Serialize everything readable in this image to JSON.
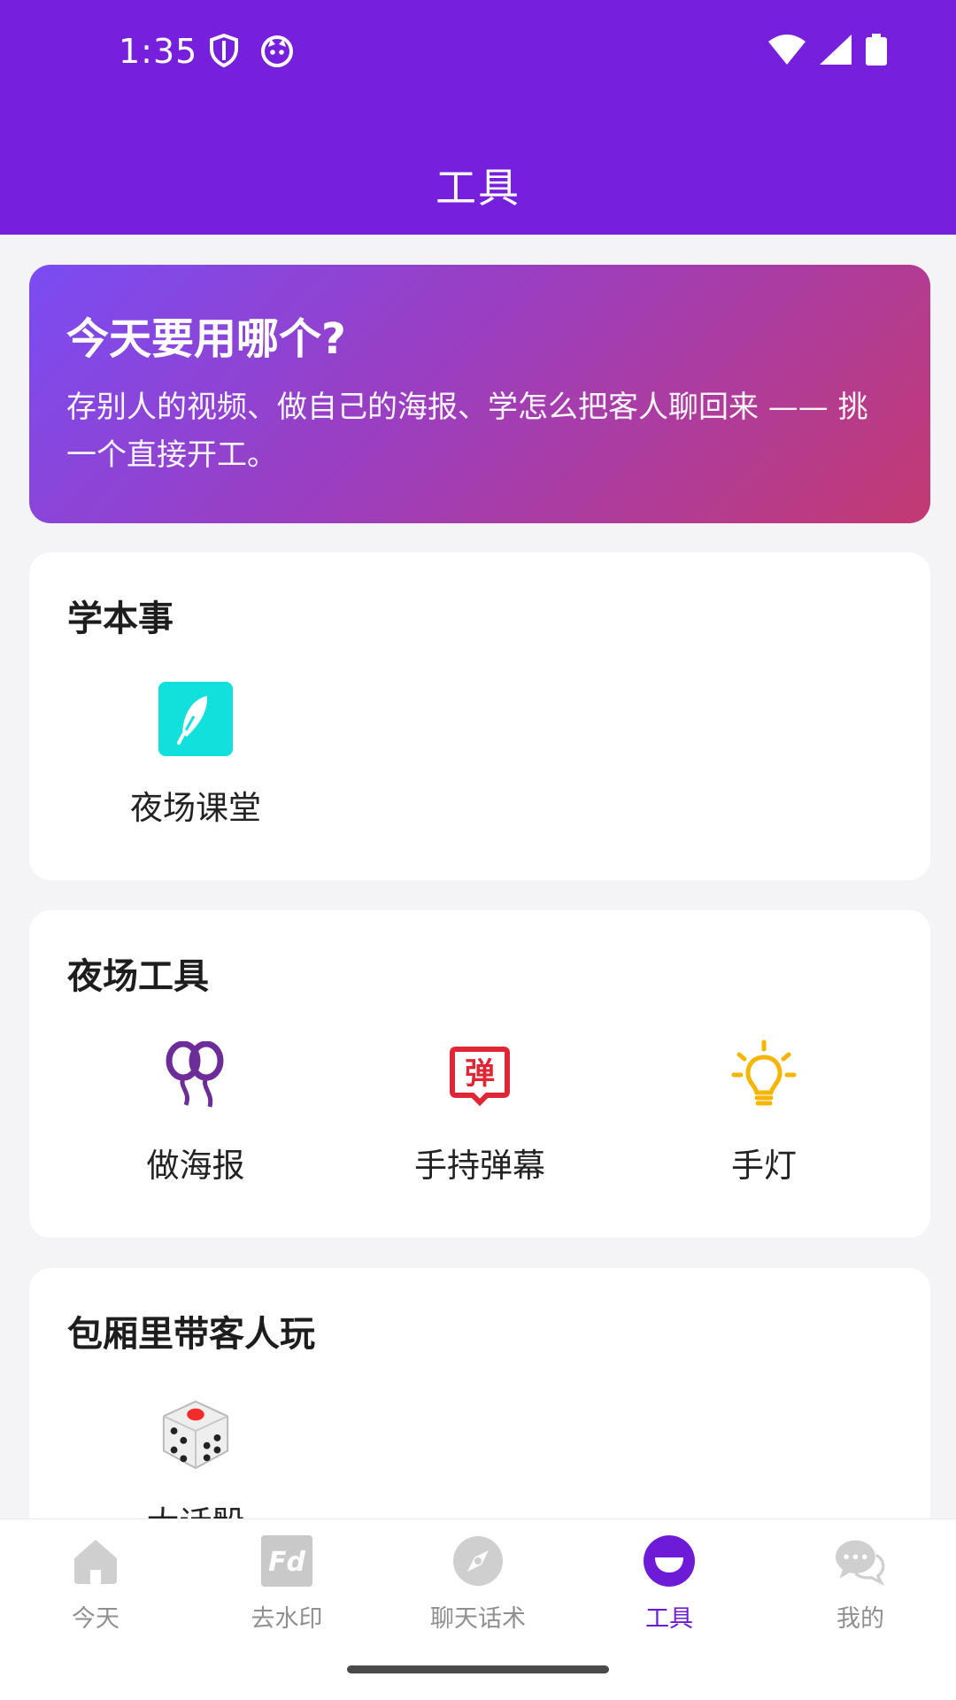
{
  "status": {
    "time": "1:35"
  },
  "header": {
    "title": "工具"
  },
  "hero": {
    "title": "今天要用哪个?",
    "description": "存别人的视频、做自己的海报、学怎么把客人聊回来 —— 挑一个直接开工。"
  },
  "sections": [
    {
      "title": "学本事",
      "items": [
        {
          "label": "夜场课堂",
          "icon": "feather-icon"
        }
      ]
    },
    {
      "title": "夜场工具",
      "items": [
        {
          "label": "做海报",
          "icon": "balloons-icon"
        },
        {
          "label": "手持弹幕",
          "icon": "danmaku-icon"
        },
        {
          "label": "手灯",
          "icon": "lightbulb-icon"
        }
      ]
    },
    {
      "title": "包厢里带客人玩",
      "items": [
        {
          "label": "大话骰",
          "icon": "dice-icon"
        }
      ]
    }
  ],
  "tabs": [
    {
      "label": "今天",
      "icon": "home-icon"
    },
    {
      "label": "去水印",
      "icon": "watermark-icon"
    },
    {
      "label": "聊天话术",
      "icon": "compass-icon"
    },
    {
      "label": "工具",
      "icon": "tools-icon",
      "active": true
    },
    {
      "label": "我的",
      "icon": "chat-bubbles-icon"
    }
  ],
  "colors": {
    "primary": "#7620dd",
    "active_tab": "#6d1bd6",
    "teal": "#11e0dc",
    "red": "#e02634",
    "yellow": "#f5b500",
    "purple": "#6d2d99"
  }
}
